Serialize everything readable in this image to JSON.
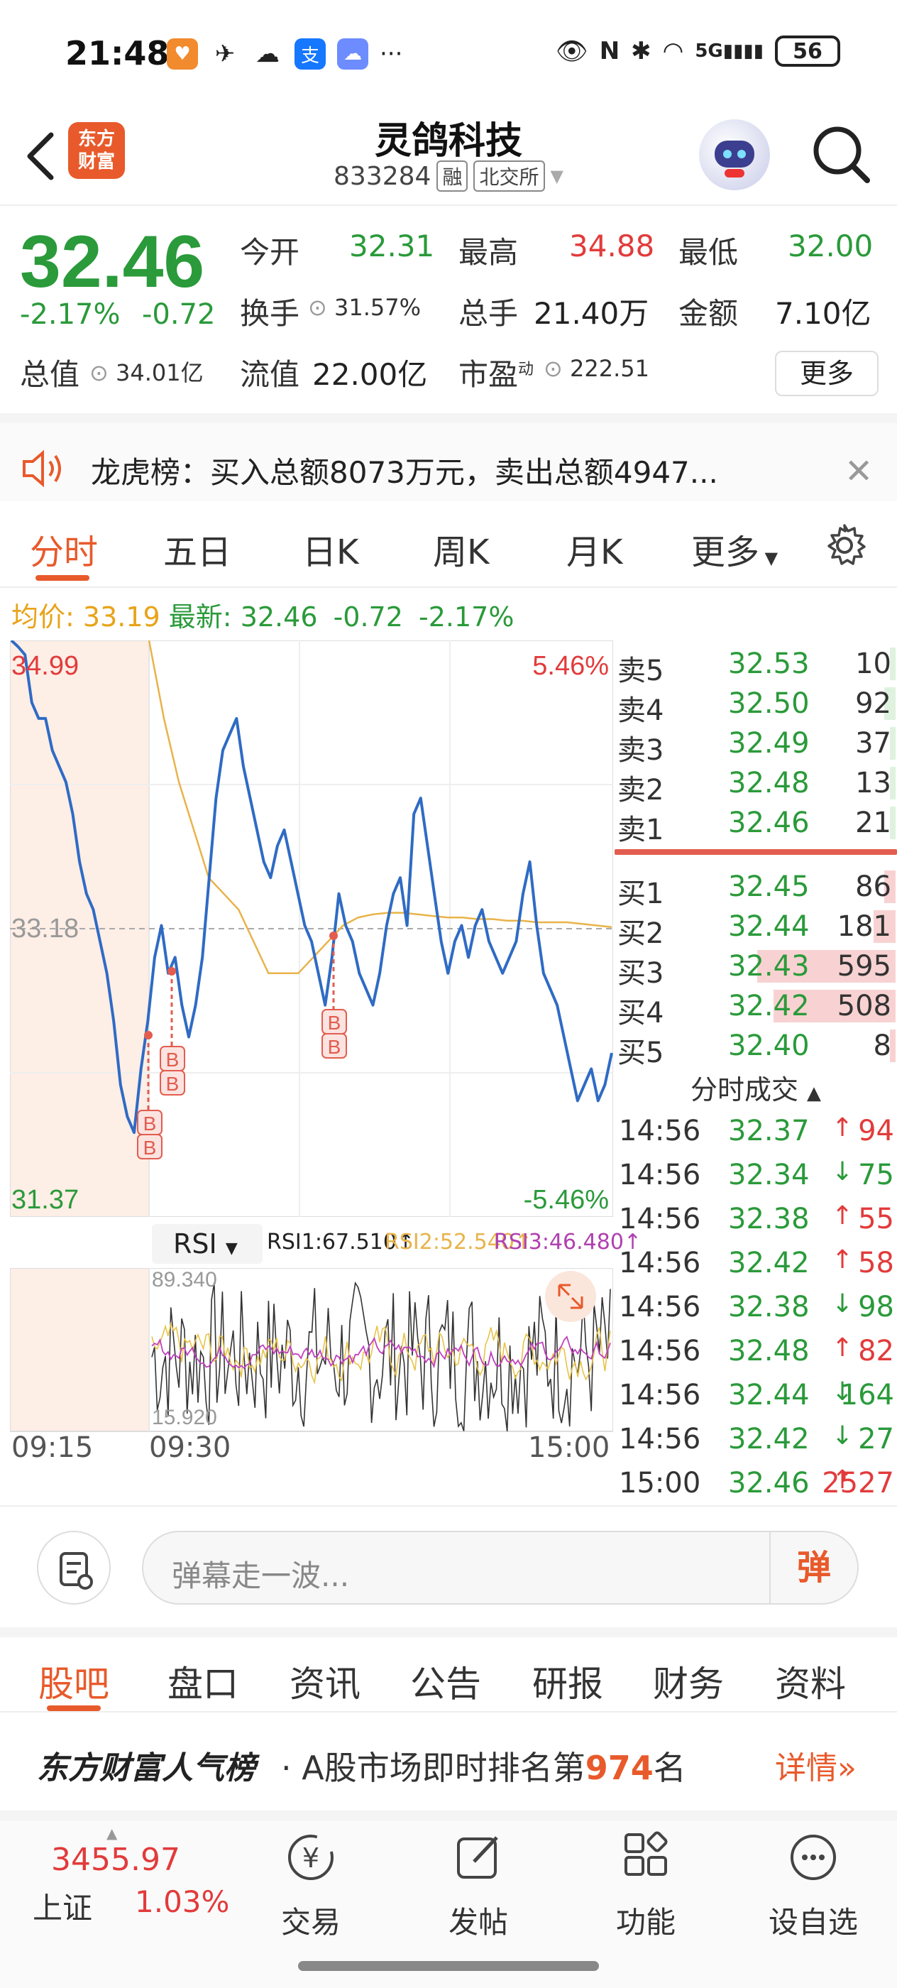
{
  "status": {
    "time": "21:48",
    "battery": "56",
    "network": "5G"
  },
  "header": {
    "logo_text": "东方\n财富",
    "title": "灵鸽科技",
    "code": "833284",
    "tag_margin": "融",
    "tag_exchange": "北交所"
  },
  "quote": {
    "price": "32.46",
    "change_pct": "-2.17%",
    "change": "-0.72",
    "open_label": "今开",
    "open": "32.31",
    "high_label": "最高",
    "high": "34.88",
    "low_label": "最低",
    "low": "32.00",
    "turnover_label": "换手",
    "turnover": "31.57%",
    "volume_label": "总手",
    "volume": "21.40万",
    "amount_label": "金额",
    "amount": "7.10亿",
    "mktcap_label": "总值",
    "mktcap": "34.01亿",
    "float_label": "流值",
    "float_cap": "22.00亿",
    "pe_label": "市盈",
    "pe_sup": "动",
    "pe": "222.51",
    "more": "更多"
  },
  "banner": {
    "text": "龙虎榜：买入总额8073万元，卖出总额4947..."
  },
  "tabs": [
    "分时",
    "五日",
    "日K",
    "周K",
    "月K",
    "更多"
  ],
  "avg_row": {
    "avg_label": "均价:",
    "avg": "33.19",
    "latest_label": "最新:",
    "latest": "32.46",
    "chg": "-0.72",
    "pct": "-2.17%"
  },
  "chart": {
    "top_price": "34.99",
    "bottom_price": "31.37",
    "mid_price": "33.18",
    "top_pct": "5.46%",
    "bottom_pct": "-5.46%",
    "marker": "B"
  },
  "chart_data": {
    "type": "line",
    "ylim": [
      31.37,
      34.99
    ],
    "reference": 33.18,
    "series": [
      {
        "values": [
          34.99,
          34.95,
          34.9,
          34.6,
          34.5,
          34.5,
          34.3,
          34.2,
          34.1,
          33.9,
          33.6,
          33.4,
          33.3,
          33.1,
          32.9,
          32.6,
          32.2,
          32.0,
          31.9,
          32.3,
          32.6,
          33.0,
          33.2,
          32.9,
          33.0,
          32.7,
          32.5,
          32.7,
          33.0,
          33.5,
          34.0,
          34.3,
          34.4,
          34.5,
          34.2,
          34.0,
          33.8,
          33.6,
          33.5,
          33.7,
          33.8,
          33.6,
          33.4,
          33.2,
          33.1,
          32.9,
          32.7,
          33.0,
          33.4,
          33.2,
          33.1,
          32.9,
          32.8,
          32.7,
          32.9,
          33.2,
          33.4,
          33.5,
          33.2,
          33.9,
          34.0,
          33.7,
          33.4,
          33.1,
          32.9,
          33.1,
          33.2,
          33.0,
          33.2,
          33.3,
          33.1,
          33.0,
          32.9,
          33.0,
          33.1,
          33.4,
          33.6,
          33.2,
          32.9,
          32.8,
          32.7,
          32.5,
          32.3,
          32.1,
          32.2,
          32.3,
          32.1,
          32.2,
          32.4
        ]
      },
      {
        "values": [
          34.99,
          34.5,
          34.1,
          33.8,
          33.5,
          33.4,
          33.3,
          33.1,
          32.9,
          32.9,
          32.9,
          33.0,
          33.1,
          33.2,
          33.25,
          33.27,
          33.28,
          33.28,
          33.27,
          33.26,
          33.25,
          33.25,
          33.24,
          33.24,
          33.23,
          33.23,
          33.22,
          33.22,
          33.22,
          33.21,
          33.2,
          33.19
        ]
      }
    ]
  },
  "rsi": {
    "label": "RSI",
    "rsi1": "RSI1:67.510↑",
    "rsi2": "RSI2:52.540↑",
    "rsi3": "RSI3:46.480↑",
    "max": "89.340",
    "min": "15.920",
    "t_start": "09:15",
    "t_open": "09:30",
    "t_end": "15:00"
  },
  "orderbook": {
    "asks": [
      {
        "label": "卖5",
        "price": "32.53",
        "vol": "10",
        "bar": 0.02
      },
      {
        "label": "卖4",
        "price": "32.50",
        "vol": "92",
        "bar": 0.04
      },
      {
        "label": "卖3",
        "price": "32.49",
        "vol": "37",
        "bar": 0.02
      },
      {
        "label": "卖2",
        "price": "32.48",
        "vol": "13",
        "bar": 0.01
      },
      {
        "label": "卖1",
        "price": "32.46",
        "vol": "21",
        "bar": 0.02
      }
    ],
    "bids": [
      {
        "label": "买1",
        "price": "32.45",
        "vol": "86",
        "bar": 0.04
      },
      {
        "label": "买2",
        "price": "32.44",
        "vol": "181",
        "bar": 0.08
      },
      {
        "label": "买3",
        "price": "32.43",
        "vol": "595",
        "bar": 0.5
      },
      {
        "label": "买4",
        "price": "32.42",
        "vol": "508",
        "bar": 0.44
      },
      {
        "label": "买5",
        "price": "32.40",
        "vol": "8",
        "bar": 0.01
      }
    ]
  },
  "trades": {
    "header": "分时成交",
    "rows": [
      {
        "time": "14:56",
        "price": "32.37",
        "dir": "↑",
        "vol": "94",
        "up": true
      },
      {
        "time": "14:56",
        "price": "32.34",
        "dir": "↓",
        "vol": "75",
        "up": false
      },
      {
        "time": "14:56",
        "price": "32.38",
        "dir": "↑",
        "vol": "55",
        "up": true
      },
      {
        "time": "14:56",
        "price": "32.42",
        "dir": "↑",
        "vol": "58",
        "up": true
      },
      {
        "time": "14:56",
        "price": "32.38",
        "dir": "↓",
        "vol": "98",
        "up": false
      },
      {
        "time": "14:56",
        "price": "32.48",
        "dir": "↑",
        "vol": "82",
        "up": true
      },
      {
        "time": "14:56",
        "price": "32.44",
        "dir": "↓",
        "vol": "164",
        "up": false
      },
      {
        "time": "14:56",
        "price": "32.42",
        "dir": "↓",
        "vol": "27",
        "up": false
      },
      {
        "time": "15:00",
        "price": "32.46",
        "dir": "↑",
        "vol": "2527",
        "up": true
      }
    ]
  },
  "danmu": {
    "placeholder": "弹幕走一波...",
    "button": "弹"
  },
  "subtabs": [
    "股吧",
    "盘口",
    "资讯",
    "公告",
    "研报",
    "财务",
    "资料"
  ],
  "rank": {
    "brand": "东方财富人气榜",
    "text_pre": "· A股市场即时排名第",
    "num": "974",
    "text_post": "名",
    "detail": "详情»"
  },
  "bottomnav": {
    "index_value": "3455.97",
    "index_name": "上证",
    "index_change": "1.03%",
    "items": [
      "交易",
      "发帖",
      "功能",
      "设自选"
    ]
  }
}
